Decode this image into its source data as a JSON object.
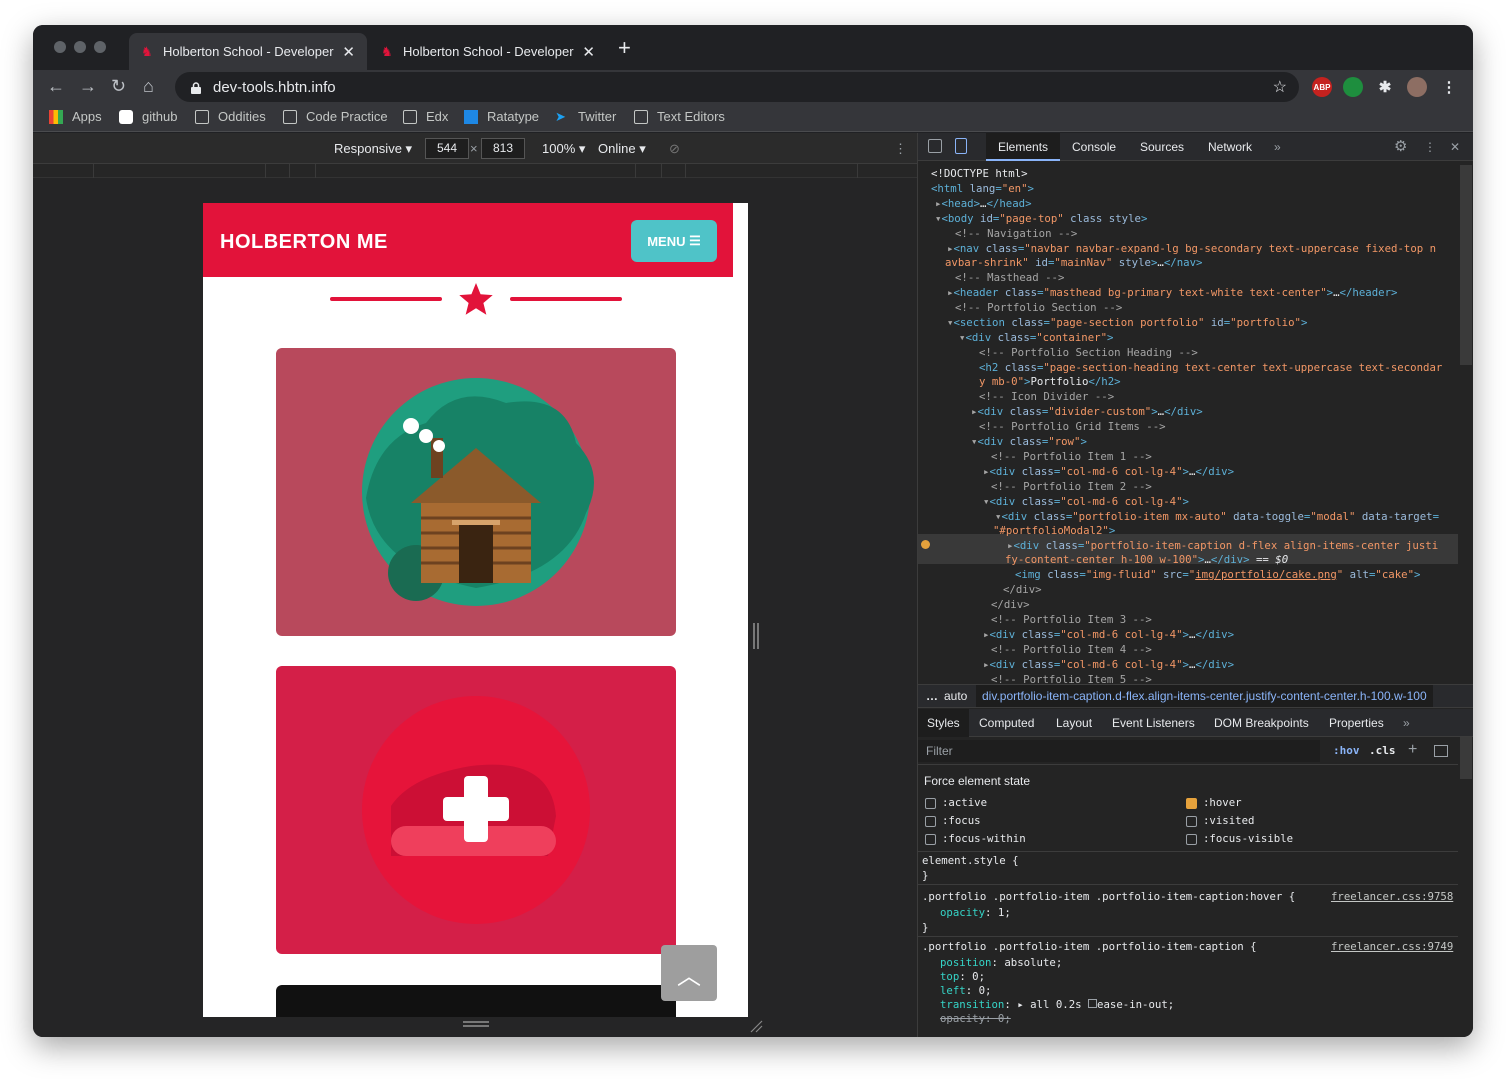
{
  "browser": {
    "tabs": [
      {
        "title": "Holberton School - Developer"
      },
      {
        "title": "Holberton School - Developer"
      }
    ],
    "url": "dev-tools.hbtn.info"
  },
  "bookmarks": [
    "Apps",
    "github",
    "Oddities",
    "Code Practice",
    "Edx",
    "Ratatype",
    "Twitter",
    "Text Editors"
  ],
  "device_bar": {
    "mode": "Responsive",
    "width": "544",
    "height": "813",
    "zoom": "100%",
    "network": "Online"
  },
  "site": {
    "brand": "HOLBERTON ME",
    "menu": "MENU"
  },
  "devtools": {
    "tabs": [
      "Elements",
      "Console",
      "Sources",
      "Network"
    ],
    "breadcrumb_left": "auto",
    "breadcrumb": "div.portfolio-item-caption.d-flex.align-items-center.justify-content-center.h-100.w-100",
    "sub_tabs": [
      "Styles",
      "Computed",
      "Layout",
      "Event Listeners",
      "DOM Breakpoints",
      "Properties"
    ],
    "filter_placeholder": "Filter",
    "hov": ":hov",
    "cls": ".cls",
    "force_state_title": "Force element state",
    "states": [
      ":active",
      ":hover",
      ":focus",
      ":visited",
      ":focus-within",
      ":focus-visible"
    ],
    "rules": [
      {
        "selector": "element.style {",
        "close": "}"
      },
      {
        "selector": ".portfolio .portfolio-item .portfolio-item-caption:hover {",
        "source": "freelancer.css:9758",
        "decls": [
          "opacity: 1;"
        ],
        "close": "}"
      },
      {
        "selector": ".portfolio .portfolio-item .portfolio-item-caption {",
        "source": "freelancer.css:9749",
        "decls": [
          "position: absolute;",
          "top: 0;",
          "left: 0;",
          "transition: ▸ all 0.2s ease-in-out;",
          "opacity: 0;"
        ]
      }
    ]
  }
}
